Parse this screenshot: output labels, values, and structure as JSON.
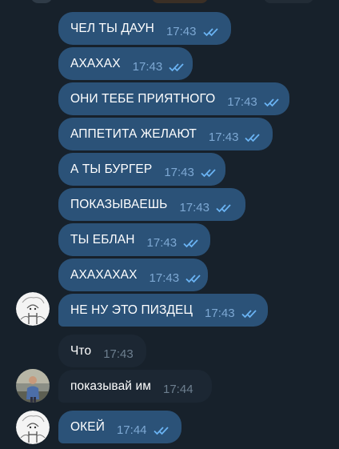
{
  "chat": {
    "messages": [
      {
        "text": "ЧЕЛ ТЫ ДАУН",
        "time": "17:43"
      },
      {
        "text": "АХАХАХ",
        "time": "17:43"
      },
      {
        "text": "ОНИ ТЕБЕ ПРИЯТНОГО",
        "time": "17:43"
      },
      {
        "text": "АППЕТИТА ЖЕЛАЮТ",
        "time": "17:43"
      },
      {
        "text": "А ТЫ БУРГЕР",
        "time": "17:43"
      },
      {
        "text": "ПОКАЗЫВАЕШЬ",
        "time": "17:43"
      },
      {
        "text": "ТЫ ЕБЛАН",
        "time": "17:43"
      },
      {
        "text": "АХАХАХАХ",
        "time": "17:43"
      },
      {
        "text": "НЕ НУ ЭТО ПИЗДЕЦ",
        "time": "17:43"
      },
      {
        "text": "Что",
        "time": "17:43"
      },
      {
        "text": "показывай им",
        "time": "17:44"
      },
      {
        "text": "ОКЕЙ",
        "time": "17:44"
      }
    ]
  },
  "colors": {
    "background": "#17212b",
    "outgoing_bubble": "#2b5278",
    "incoming_bubble": "#1c2733",
    "read_check": "#6ab3f3"
  },
  "icons": {
    "read_receipt": "double-check-icon",
    "avatar_a": "sketch-avatar",
    "avatar_b": "photo-avatar"
  }
}
